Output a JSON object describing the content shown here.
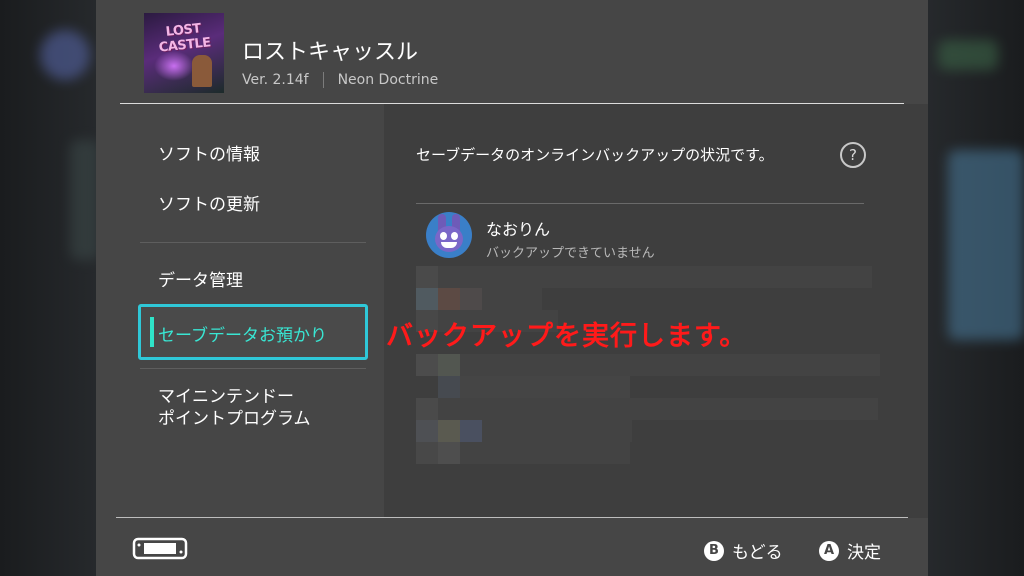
{
  "game": {
    "title": "ロストキャッスル",
    "version": "Ver. 2.14f",
    "publisher": "Neon Doctrine",
    "icon_logo_text": "LOST CASTLE"
  },
  "sidebar": {
    "items": [
      {
        "label": "ソフトの情報"
      },
      {
        "label": "ソフトの更新"
      },
      {
        "label": "データ管理"
      },
      {
        "label": "セーブデータお預かり",
        "selected": true
      },
      {
        "label_line1": "マイニンテンドー",
        "label_line2": "ポイントプログラム"
      }
    ]
  },
  "content": {
    "status_text": "セーブデータのオンラインバックアップの状況です。",
    "help_icon": "?",
    "user": {
      "name": "なおりん",
      "status": "バックアップできていません"
    }
  },
  "annotation": {
    "text": "バックアップを実行します。",
    "color": "#ff1a1a"
  },
  "footer": {
    "back": {
      "glyph": "B",
      "label": "もどる"
    },
    "confirm": {
      "glyph": "A",
      "label": "決定"
    }
  },
  "colors": {
    "panel": "#464646",
    "content": "#3e3e3e",
    "selection_border": "#2fc8d8",
    "selection_text": "#39e6d3"
  }
}
